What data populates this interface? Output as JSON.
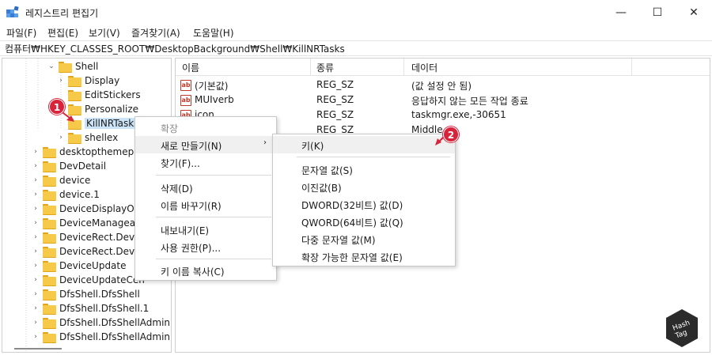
{
  "window": {
    "title": "레지스트리 편집기",
    "min": "—",
    "max": "☐",
    "close": "✕"
  },
  "menu": [
    "파일(F)",
    "편집(E)",
    "보기(V)",
    "즐겨찾기(A)",
    "도움말(H)"
  ],
  "address": "컴퓨터₩HKEY_CLASSES_ROOT₩DesktopBackground₩Shell₩KillNRTasks",
  "tree": [
    {
      "label": "Shell",
      "chev": "⌄",
      "expanded": true
    },
    {
      "label": "Display",
      "chev": "›"
    },
    {
      "label": "EditStickers",
      "chev": ""
    },
    {
      "label": "Personalize",
      "chev": ""
    },
    {
      "label": "KillNRTasks",
      "chev": "",
      "selected": true
    },
    {
      "label": "shellex",
      "chev": "›"
    },
    {
      "label": "desktopthemepac",
      "chev": "›"
    },
    {
      "label": "DevDetail",
      "chev": "›"
    },
    {
      "label": "device",
      "chev": "›"
    },
    {
      "label": "device.1",
      "chev": "›"
    },
    {
      "label": "DeviceDisplayObj",
      "chev": "›"
    },
    {
      "label": "DeviceManageab",
      "chev": "›"
    },
    {
      "label": "DeviceRect.Device",
      "chev": "›"
    },
    {
      "label": "DeviceRect.Device",
      "chev": "›"
    },
    {
      "label": "DeviceUpdate",
      "chev": "›"
    },
    {
      "label": "DeviceUpdateCen",
      "chev": "›"
    },
    {
      "label": "DfsShell.DfsShell",
      "chev": "›"
    },
    {
      "label": "DfsShell.DfsShell.1",
      "chev": "›"
    },
    {
      "label": "DfsShell.DfsShellAdmin",
      "chev": "›"
    },
    {
      "label": "DfsShell.DfsShellAdmin",
      "chev": "›"
    }
  ],
  "columns": {
    "name": "이름",
    "type": "종류",
    "data": "데이터"
  },
  "values": [
    {
      "icon": "ab",
      "name": "(기본값)",
      "type": "REG_SZ",
      "data": "(값 설정 안 됨)"
    },
    {
      "icon": "ab",
      "name": "MUIverb",
      "type": "REG_SZ",
      "data": "응답하지 않는 모든 작업 종료"
    },
    {
      "icon": "ab",
      "name": "icon",
      "type": "REG_SZ",
      "data": "taskmgr.exe,-30651"
    },
    {
      "icon": "ab",
      "name": "",
      "type": "REG_SZ",
      "data": "Middle"
    }
  ],
  "context_menu": {
    "expand": "확장",
    "new": "새로 만들기(N)",
    "new_arrow": "›",
    "find": "찾기(F)...",
    "delete": "삭제(D)",
    "rename": "이름 바꾸기(R)",
    "export": "내보내기(E)",
    "permissions": "사용 권한(P)...",
    "copy_key": "키 이름 복사(C)"
  },
  "submenu": {
    "key": "키(K)",
    "string": "문자열 값(S)",
    "binary": "이진값(B)",
    "dword": "DWORD(32비트) 값(D)",
    "qword": "QWORD(64비트) 값(Q)",
    "multi": "다중 문자열 값(M)",
    "expand_string": "확장 가능한 문자열 값(E)"
  },
  "badges": {
    "one": "1",
    "two": "2"
  },
  "logo": {
    "line1": "Hash",
    "line2": "Tag"
  },
  "colors": {
    "badge": "#d9233b",
    "selection": "#cce4f7",
    "folder": "#f7c948"
  }
}
